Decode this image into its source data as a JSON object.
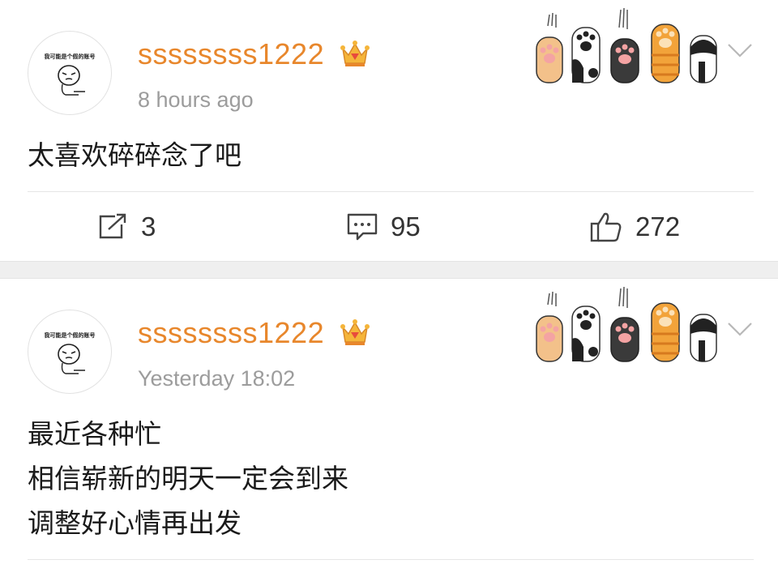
{
  "posts": [
    {
      "avatar_text": "我可能是个假的账号",
      "username": "ssssssss1222",
      "timestamp": "8 hours ago",
      "content_lines": [
        "太喜欢碎碎念了吧"
      ],
      "actions": {
        "repost_count": "3",
        "comment_count": "95",
        "like_count": "272"
      }
    },
    {
      "avatar_text": "我可能是个假的账号",
      "username": "ssssssss1222",
      "timestamp": "Yesterday 18:02",
      "content_lines": [
        "最近各种忙",
        "相信崭新的明天一定会到来",
        "调整好心情再出发"
      ]
    }
  ],
  "colors": {
    "username": "#e8872c",
    "timestamp": "#9c9c9c",
    "separator": "#efefef"
  },
  "icons": [
    "crown-icon",
    "cat-paws-decoration",
    "chevron-down-icon",
    "repost-icon",
    "comment-icon",
    "like-icon"
  ]
}
